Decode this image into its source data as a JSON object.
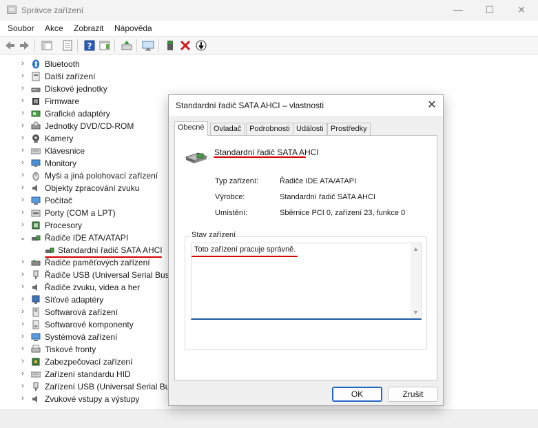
{
  "window": {
    "title": "Správce zařízení",
    "minimize_glyph": "—",
    "maximize_glyph": "☐",
    "close_glyph": "✕"
  },
  "menu": [
    "Soubor",
    "Akce",
    "Zobrazit",
    "Nápověda"
  ],
  "toolbar": {
    "icons": [
      "back-arrow-icon",
      "forward-arrow-icon",
      "show-hide-console-tree-icon",
      "properties-icon",
      "help-icon",
      "action-pane-icon",
      "update-driver-icon",
      "display-icon",
      "enable-device-icon",
      "uninstall-device-icon",
      "disable-device-icon"
    ]
  },
  "tree": {
    "items": [
      {
        "label": "Bluetooth",
        "icon": "bluetooth-icon",
        "expanded": false
      },
      {
        "label": "Další zařízení",
        "icon": "other-devices-icon",
        "expanded": false
      },
      {
        "label": "Diskové jednotky",
        "icon": "disk-drive-icon",
        "expanded": false
      },
      {
        "label": "Firmware",
        "icon": "firmware-icon",
        "expanded": false
      },
      {
        "label": "Grafické adaptéry",
        "icon": "display-adapter-icon",
        "expanded": false
      },
      {
        "label": "Jednotky DVD/CD-ROM",
        "icon": "dvd-drive-icon",
        "expanded": false
      },
      {
        "label": "Kamery",
        "icon": "camera-icon",
        "expanded": false
      },
      {
        "label": "Klávesnice",
        "icon": "keyboard-icon",
        "expanded": false
      },
      {
        "label": "Monitory",
        "icon": "monitor-icon",
        "expanded": false
      },
      {
        "label": "Myši a jiná polohovací zařízení",
        "icon": "mouse-icon",
        "expanded": false
      },
      {
        "label": "Objekty zpracování zvuku",
        "icon": "audio-processing-icon",
        "expanded": false
      },
      {
        "label": "Počítač",
        "icon": "computer-icon",
        "expanded": false
      },
      {
        "label": "Porty (COM a LPT)",
        "icon": "port-icon",
        "expanded": false
      },
      {
        "label": "Procesory",
        "icon": "processor-icon",
        "expanded": false
      },
      {
        "label": "Řadiče IDE ATA/ATAPI",
        "icon": "ide-controller-icon",
        "expanded": true
      },
      {
        "label": "Standardní řadič  SATA AHCI",
        "icon": "sata-controller-icon",
        "child": true
      },
      {
        "label": "Řadiče paměťových zařízení",
        "icon": "storage-controller-icon",
        "expanded": false
      },
      {
        "label": "Řadiče USB (Universal Serial Bus)",
        "icon": "usb-controller-icon",
        "expanded": false
      },
      {
        "label": "Řadiče zvuku, videa a her",
        "icon": "sound-controller-icon",
        "expanded": false
      },
      {
        "label": "Síťové adaptéry",
        "icon": "network-adapter-icon",
        "expanded": false
      },
      {
        "label": "Softwarová zařízení",
        "icon": "software-device-icon",
        "expanded": false
      },
      {
        "label": "Softwarové komponenty",
        "icon": "software-component-icon",
        "expanded": false
      },
      {
        "label": "Systémová zařízení",
        "icon": "system-device-icon",
        "expanded": false
      },
      {
        "label": "Tiskové fronty",
        "icon": "print-queue-icon",
        "expanded": false
      },
      {
        "label": "Zabezpečovací zařízení",
        "icon": "security-device-icon",
        "expanded": false
      },
      {
        "label": "Zařízení standardu HID",
        "icon": "hid-device-icon",
        "expanded": false
      },
      {
        "label": "Zařízení USB (Universal Serial Bus)",
        "icon": "usb-device-icon",
        "expanded": false
      },
      {
        "label": "Zvukové vstupy a výstupy",
        "icon": "audio-io-icon",
        "expanded": false
      }
    ]
  },
  "dialog": {
    "title": "Standardní řadič  SATA AHCI – vlastnosti",
    "close_glyph": "✕",
    "tabs": [
      "Obecné",
      "Ovladač",
      "Podrobnosti",
      "Události",
      "Prostředky"
    ],
    "active_tab": "Obecné",
    "device_name": "Standardní řadič  SATA AHCI",
    "properties": [
      {
        "label": "Typ zařízení:",
        "value": "Řadiče IDE ATA/ATAPI"
      },
      {
        "label": "Výrobce:",
        "value": "Standardní řadič  SATA AHCI"
      },
      {
        "label": "Umístění:",
        "value": "Sběrnice PCI 0, zařízení 23, funkce 0"
      }
    ],
    "status_group_label": "Stav zařízení",
    "status_text": "Toto zařízení pracuje správně.",
    "ok_label": "OK",
    "cancel_label": "Zrušit"
  },
  "colors": {
    "annotation_red": "#d40000",
    "focus_blue": "#1f5ba8"
  }
}
